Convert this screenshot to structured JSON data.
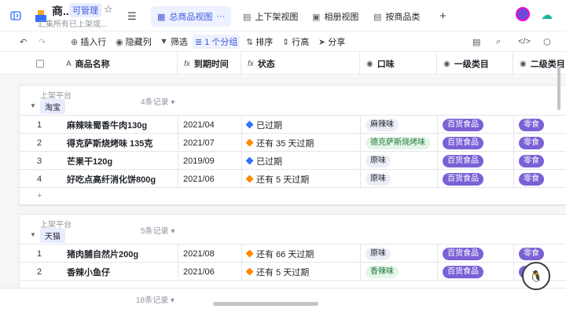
{
  "doc": {
    "title": "商...",
    "perm_badge": "可管理",
    "subtitle": "汇集所有已上架或..."
  },
  "tabs": [
    {
      "label": "总商品视图",
      "active": true,
      "icon": "table-icon"
    },
    {
      "label": "上下架视图",
      "active": false,
      "icon": "table-icon"
    },
    {
      "label": "相册视图",
      "active": false,
      "icon": "gallery-icon"
    },
    {
      "label": "按商品类",
      "active": false,
      "icon": "table-icon"
    }
  ],
  "toolbar": {
    "insert_row": "插入行",
    "hide_col": "隐藏列",
    "filter": "筛选",
    "group": "1 个分组",
    "sort": "排序",
    "row_height": "行高",
    "share": "分享"
  },
  "columns": {
    "name": "商品名称",
    "expire": "到期时间",
    "status": "状态",
    "taste": "口味",
    "cat1": "一级类目",
    "cat2": "二级类目"
  },
  "groups": [
    {
      "label": "上架平台",
      "tag": "淘宝",
      "count": "4条记录",
      "rows": [
        {
          "num": "1",
          "name": "麻辣味蜀香牛肉130g",
          "date": "2021/04",
          "status": "已过期",
          "status_color": "blue",
          "taste": "麻辣味",
          "taste_color": "grey",
          "cat1": "百货食品",
          "cat2": "零食"
        },
        {
          "num": "2",
          "name": "得克萨斯烧烤味 135克",
          "date": "2021/07",
          "status": "还有 35 天过期",
          "status_color": "orange",
          "taste": "德克萨斯烧烤味",
          "taste_color": "green",
          "cat1": "百货食品",
          "cat2": "零食"
        },
        {
          "num": "3",
          "name": "芒果干120g",
          "date": "2019/09",
          "status": "已过期",
          "status_color": "blue",
          "taste": "原味",
          "taste_color": "grey",
          "cat1": "百货食品",
          "cat2": "零食"
        },
        {
          "num": "4",
          "name": "好吃点高纤消化饼800g",
          "date": "2021/06",
          "status": "还有 5 天过期",
          "status_color": "orange",
          "taste": "原味",
          "taste_color": "grey",
          "cat1": "百货食品",
          "cat2": "零食"
        }
      ]
    },
    {
      "label": "上架平台",
      "tag": "天猫",
      "count": "5条记录",
      "rows": [
        {
          "num": "1",
          "name": "猪肉脯自然片200g",
          "date": "2021/08",
          "status": "还有 66 天过期",
          "status_color": "orange",
          "taste": "原味",
          "taste_color": "grey",
          "cat1": "百货食品",
          "cat2": "零食"
        },
        {
          "num": "2",
          "name": "香辣小鱼仔",
          "date": "2021/06",
          "status": "还有 5 天过期",
          "status_color": "orange",
          "taste": "香辣味",
          "taste_color": "green",
          "cat1": "百货食品",
          "cat2": "零食"
        }
      ]
    }
  ],
  "add_row": "+",
  "footer": {
    "total": "18条记录"
  },
  "colors": {
    "accent": "#3b5bdb",
    "purple_pill": "#7b61d6",
    "orange": "#ff8800",
    "blue": "#3370ff"
  }
}
